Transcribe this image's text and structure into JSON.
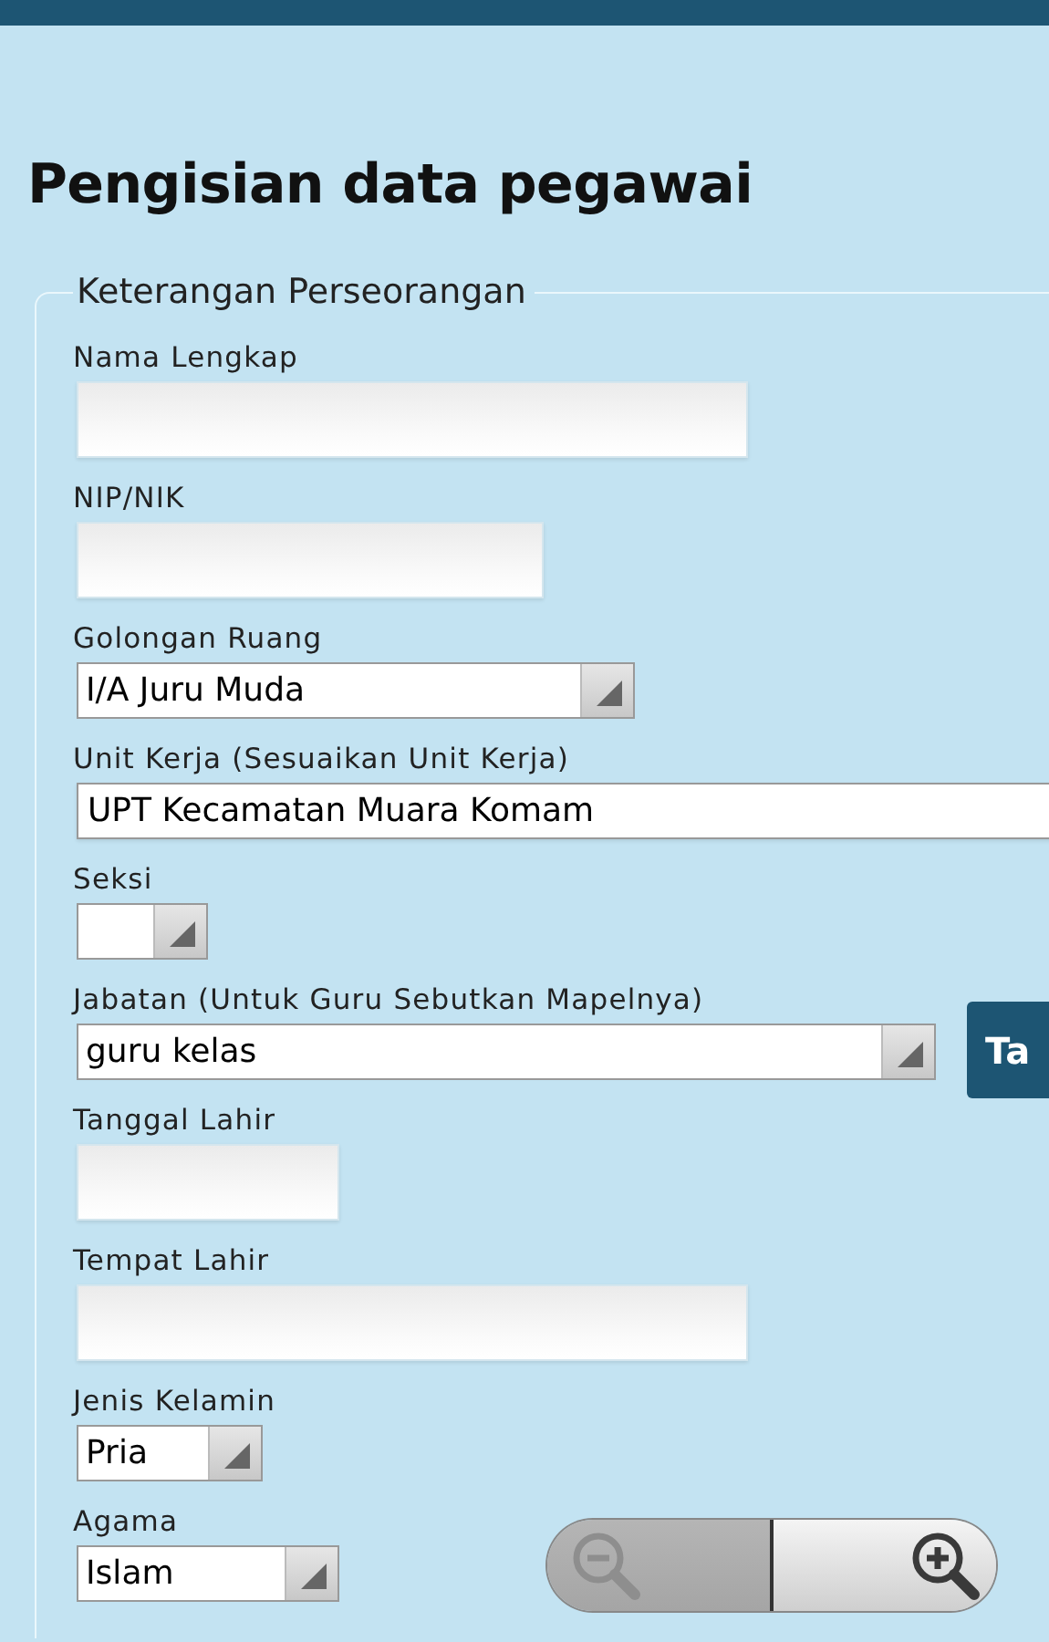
{
  "page_title": "Pengisian data pegawai",
  "section": {
    "legend": "Keterangan Perseorangan",
    "fields": [
      {
        "kind": "text",
        "label": "Nama Lengkap"
      },
      {
        "kind": "text",
        "label": "NIP/NIK"
      },
      {
        "kind": "select",
        "label": "Golongan Ruang",
        "value": "I/A Juru Muda"
      },
      {
        "kind": "text",
        "label": "Unit Kerja (Sesuaikan Unit Kerja)",
        "value": "UPT Kecamatan Muara Komam"
      },
      {
        "kind": "select",
        "label": "Seksi"
      },
      {
        "kind": "select",
        "label": "Jabatan (Untuk Guru Sebutkan Mapelnya)",
        "value": "guru kelas",
        "button": "Ta"
      },
      {
        "kind": "text",
        "label": "Tanggal Lahir"
      },
      {
        "kind": "text",
        "label": "Tempat Lahir"
      },
      {
        "kind": "select",
        "label": "Jenis Kelamin",
        "value": "Pria"
      },
      {
        "kind": "select",
        "label": "Agama",
        "value": "Islam"
      }
    ]
  },
  "zoom_controls": {
    "zoom_out": {
      "disabled": true
    },
    "zoom_in": {
      "disabled": false
    }
  }
}
